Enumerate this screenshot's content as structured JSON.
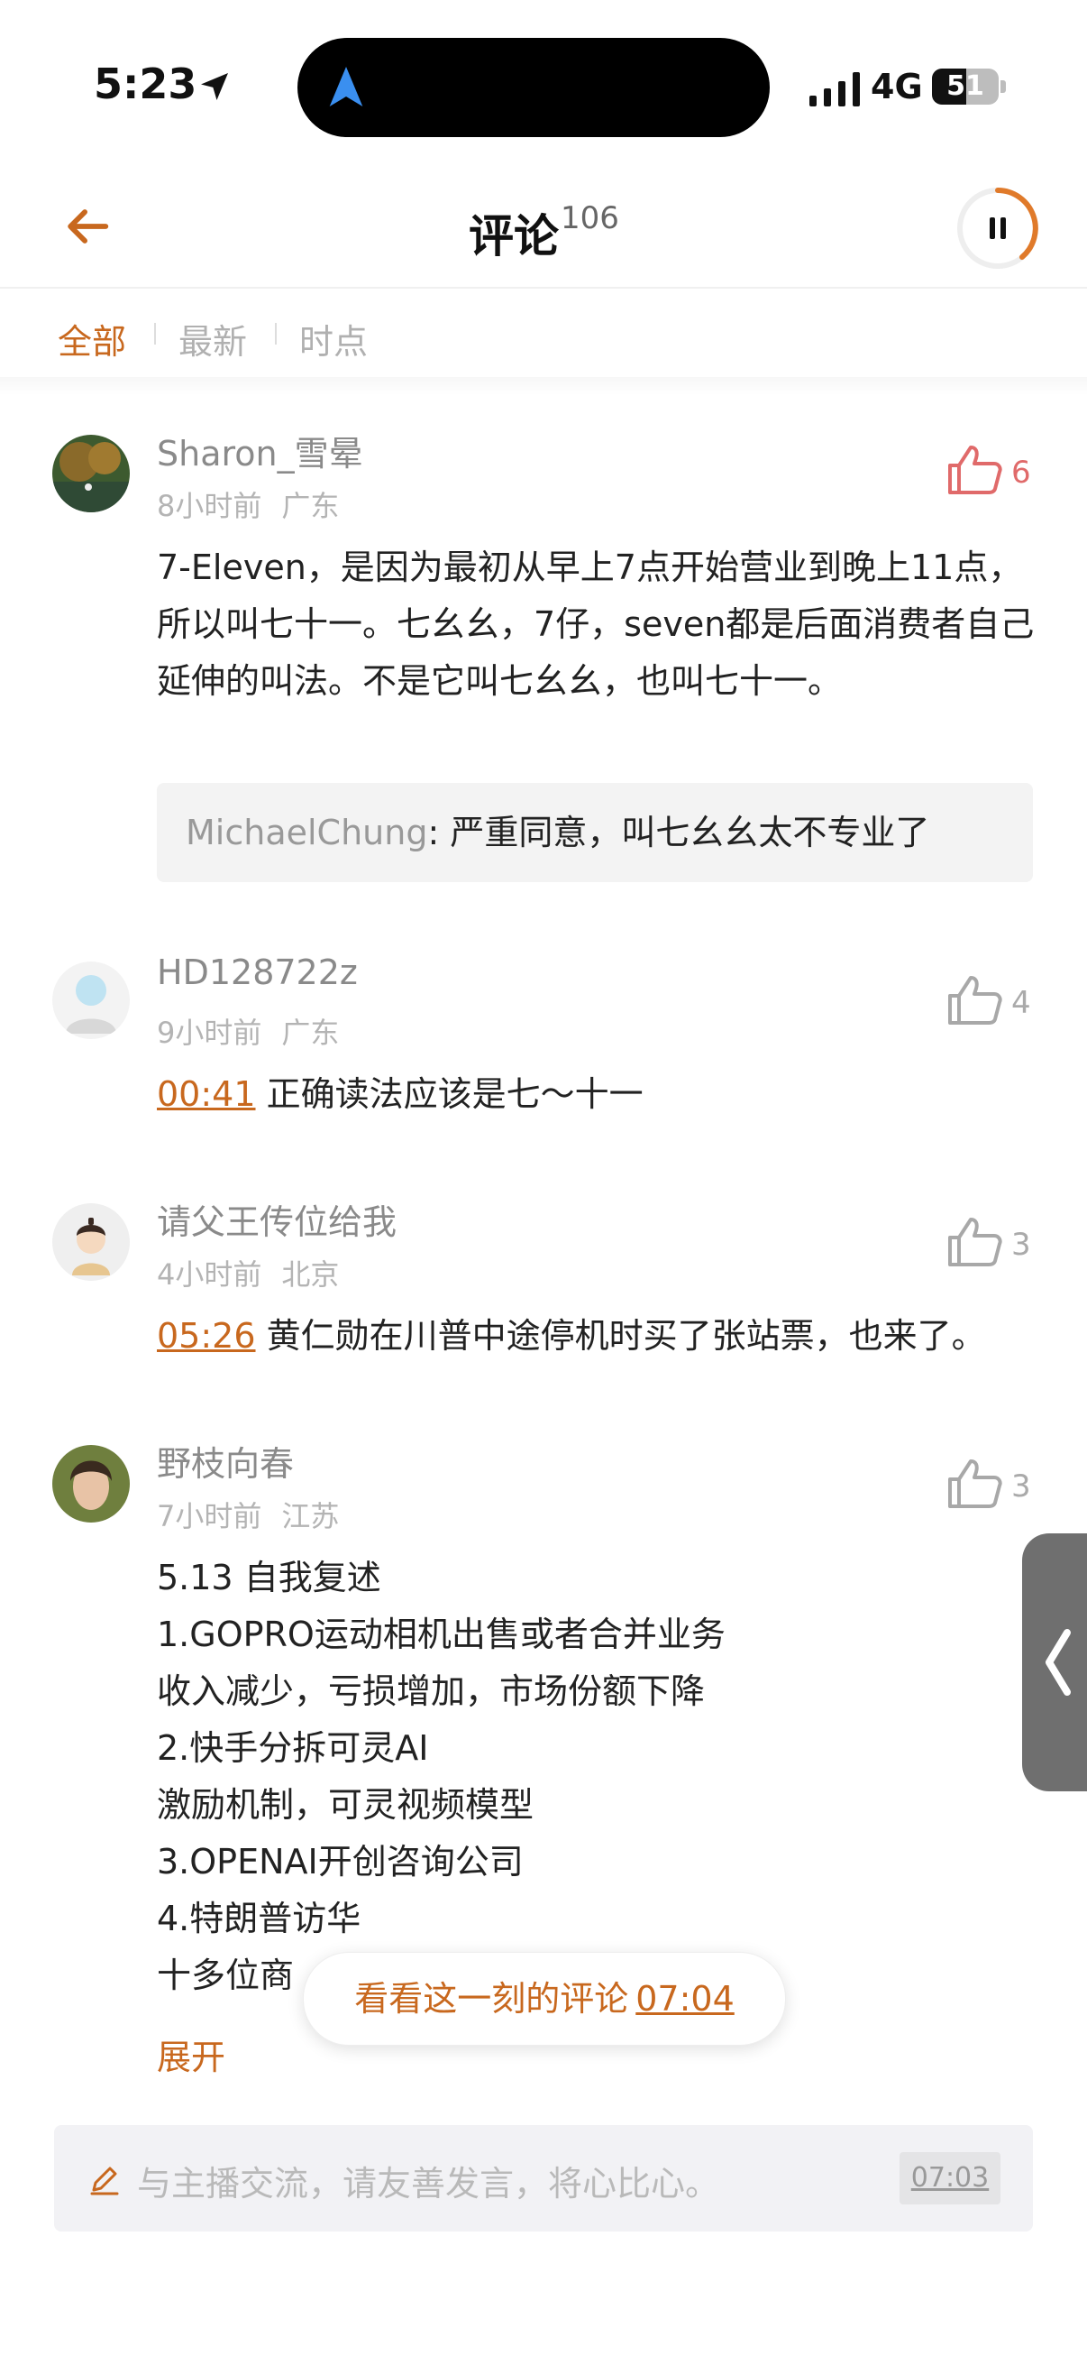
{
  "status_bar": {
    "time": "5:23",
    "network": "4G",
    "battery": "51",
    "battery_level": 0.51
  },
  "header": {
    "title": "评论",
    "count": "106"
  },
  "tabs": [
    {
      "label": "全部",
      "active": true
    },
    {
      "label": "最新",
      "active": false
    },
    {
      "label": "时点",
      "active": false
    }
  ],
  "comments": [
    {
      "user": "Sharon_雪晕",
      "time": "8小时前",
      "location": "广东",
      "likes": "6",
      "text": "7-Eleven，是因为最初从早上7点开始营业到晚上11点，所以叫七十一。七幺幺，7仔，seven都是后面消费者自己延伸的叫法。不是它叫七幺幺，也叫七十一。",
      "reply": {
        "user": "MichaelChung",
        "text": ": 严重同意，叫七幺幺太不专业了"
      }
    },
    {
      "user": "HD128722z",
      "time": "9小时前",
      "location": "广东",
      "likes": "4",
      "timestamp": "00:41",
      "text": "正确读法应该是七～十一"
    },
    {
      "user": "请父王传位给我",
      "time": "4小时前",
      "location": "北京",
      "likes": "3",
      "timestamp": "05:26",
      "text": "黄仁勋在川普中途停机时买了张站票，也来了。"
    },
    {
      "user": "野枝向春",
      "time": "7小时前",
      "location": "江苏",
      "likes": "3",
      "lines": [
        "5.13 自我复述",
        "1.GOPRO运动相机出售或者合并业务",
        "收入减少，亏损增加，市场份额下降",
        "2.快手分拆可灵AI",
        "激励机制，可灵视频模型",
        "3.OPENAI开创咨询公司",
        "4.特朗普访华",
        "十多位商"
      ],
      "expand": "展开"
    }
  ],
  "floating": {
    "label": "看看这一刻的评论",
    "time": "07:04"
  },
  "input": {
    "placeholder": "与主播交流，请友善发言，将心比心。",
    "time": "07:03"
  }
}
